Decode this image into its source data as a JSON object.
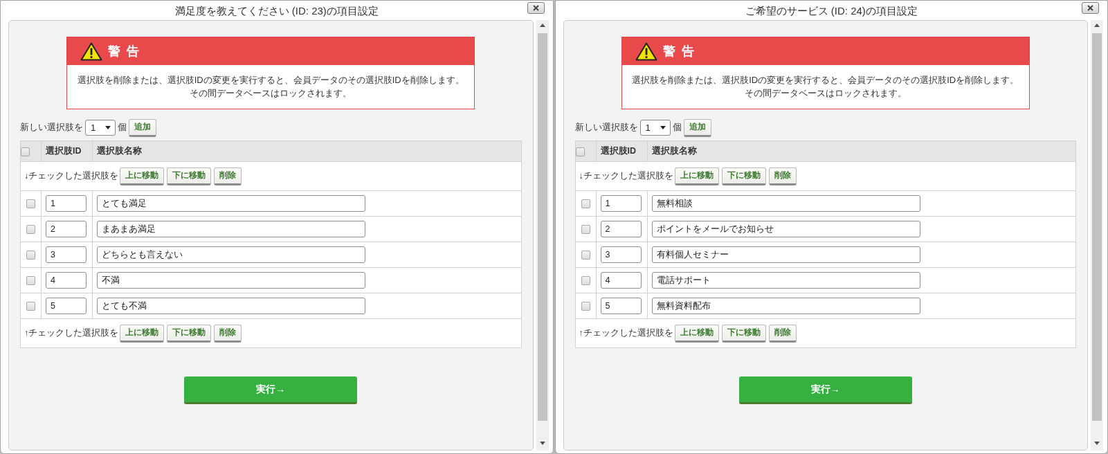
{
  "dialogs": [
    {
      "title": "満足度を教えてください (ID: 23)の項目設定",
      "warning": {
        "heading": "警 告",
        "lines": [
          "選択肢を削除または、選択肢IDの変更を実行すると、会員データのその選択肢IDを削除します。",
          "その間データベースはロックされます。"
        ]
      },
      "add_choices": {
        "label": "新しい選択肢を",
        "count": "1",
        "unit": "個",
        "button": "追加"
      },
      "table": {
        "select_all": {
          "checked": false
        },
        "columns": [
          "選択肢ID",
          "選択肢名称"
        ],
        "top_actions": {
          "label": "↓チェックした選択肢を",
          "buttons": [
            "上に移動",
            "下に移動",
            "削除"
          ]
        },
        "rows": [
          {
            "checked": false,
            "id": "1",
            "name": "とても満足"
          },
          {
            "checked": false,
            "id": "2",
            "name": "まあまあ満足"
          },
          {
            "checked": false,
            "id": "3",
            "name": "どちらとも言えない"
          },
          {
            "checked": false,
            "id": "4",
            "name": "不満"
          },
          {
            "checked": false,
            "id": "5",
            "name": "とても不満"
          }
        ],
        "bottom_actions": {
          "label": "↑チェックした選択肢を",
          "buttons": [
            "上に移動",
            "下に移動",
            "削除"
          ]
        }
      },
      "submit": "実行→"
    },
    {
      "title": "ご希望のサービス (ID: 24)の項目設定",
      "warning": {
        "heading": "警 告",
        "lines": [
          "選択肢を削除または、選択肢IDの変更を実行すると、会員データのその選択肢IDを削除します。",
          "その間データベースはロックされます。"
        ]
      },
      "add_choices": {
        "label": "新しい選択肢を",
        "count": "1",
        "unit": "個",
        "button": "追加"
      },
      "table": {
        "select_all": {
          "checked": false
        },
        "columns": [
          "選択肢ID",
          "選択肢名称"
        ],
        "top_actions": {
          "label": "↓チェックした選択肢を",
          "buttons": [
            "上に移動",
            "下に移動",
            "削除"
          ]
        },
        "rows": [
          {
            "checked": false,
            "id": "1",
            "name": "無料相談"
          },
          {
            "checked": false,
            "id": "2",
            "name": "ポイントをメールでお知らせ"
          },
          {
            "checked": false,
            "id": "3",
            "name": "有料個人セミナー"
          },
          {
            "checked": false,
            "id": "4",
            "name": "電話サポート"
          },
          {
            "checked": false,
            "id": "5",
            "name": "無料資料配布"
          }
        ],
        "bottom_actions": {
          "label": "↑チェックした選択肢を",
          "buttons": [
            "上に移動",
            "下に移動",
            "削除"
          ]
        }
      },
      "submit": "実行→"
    }
  ]
}
